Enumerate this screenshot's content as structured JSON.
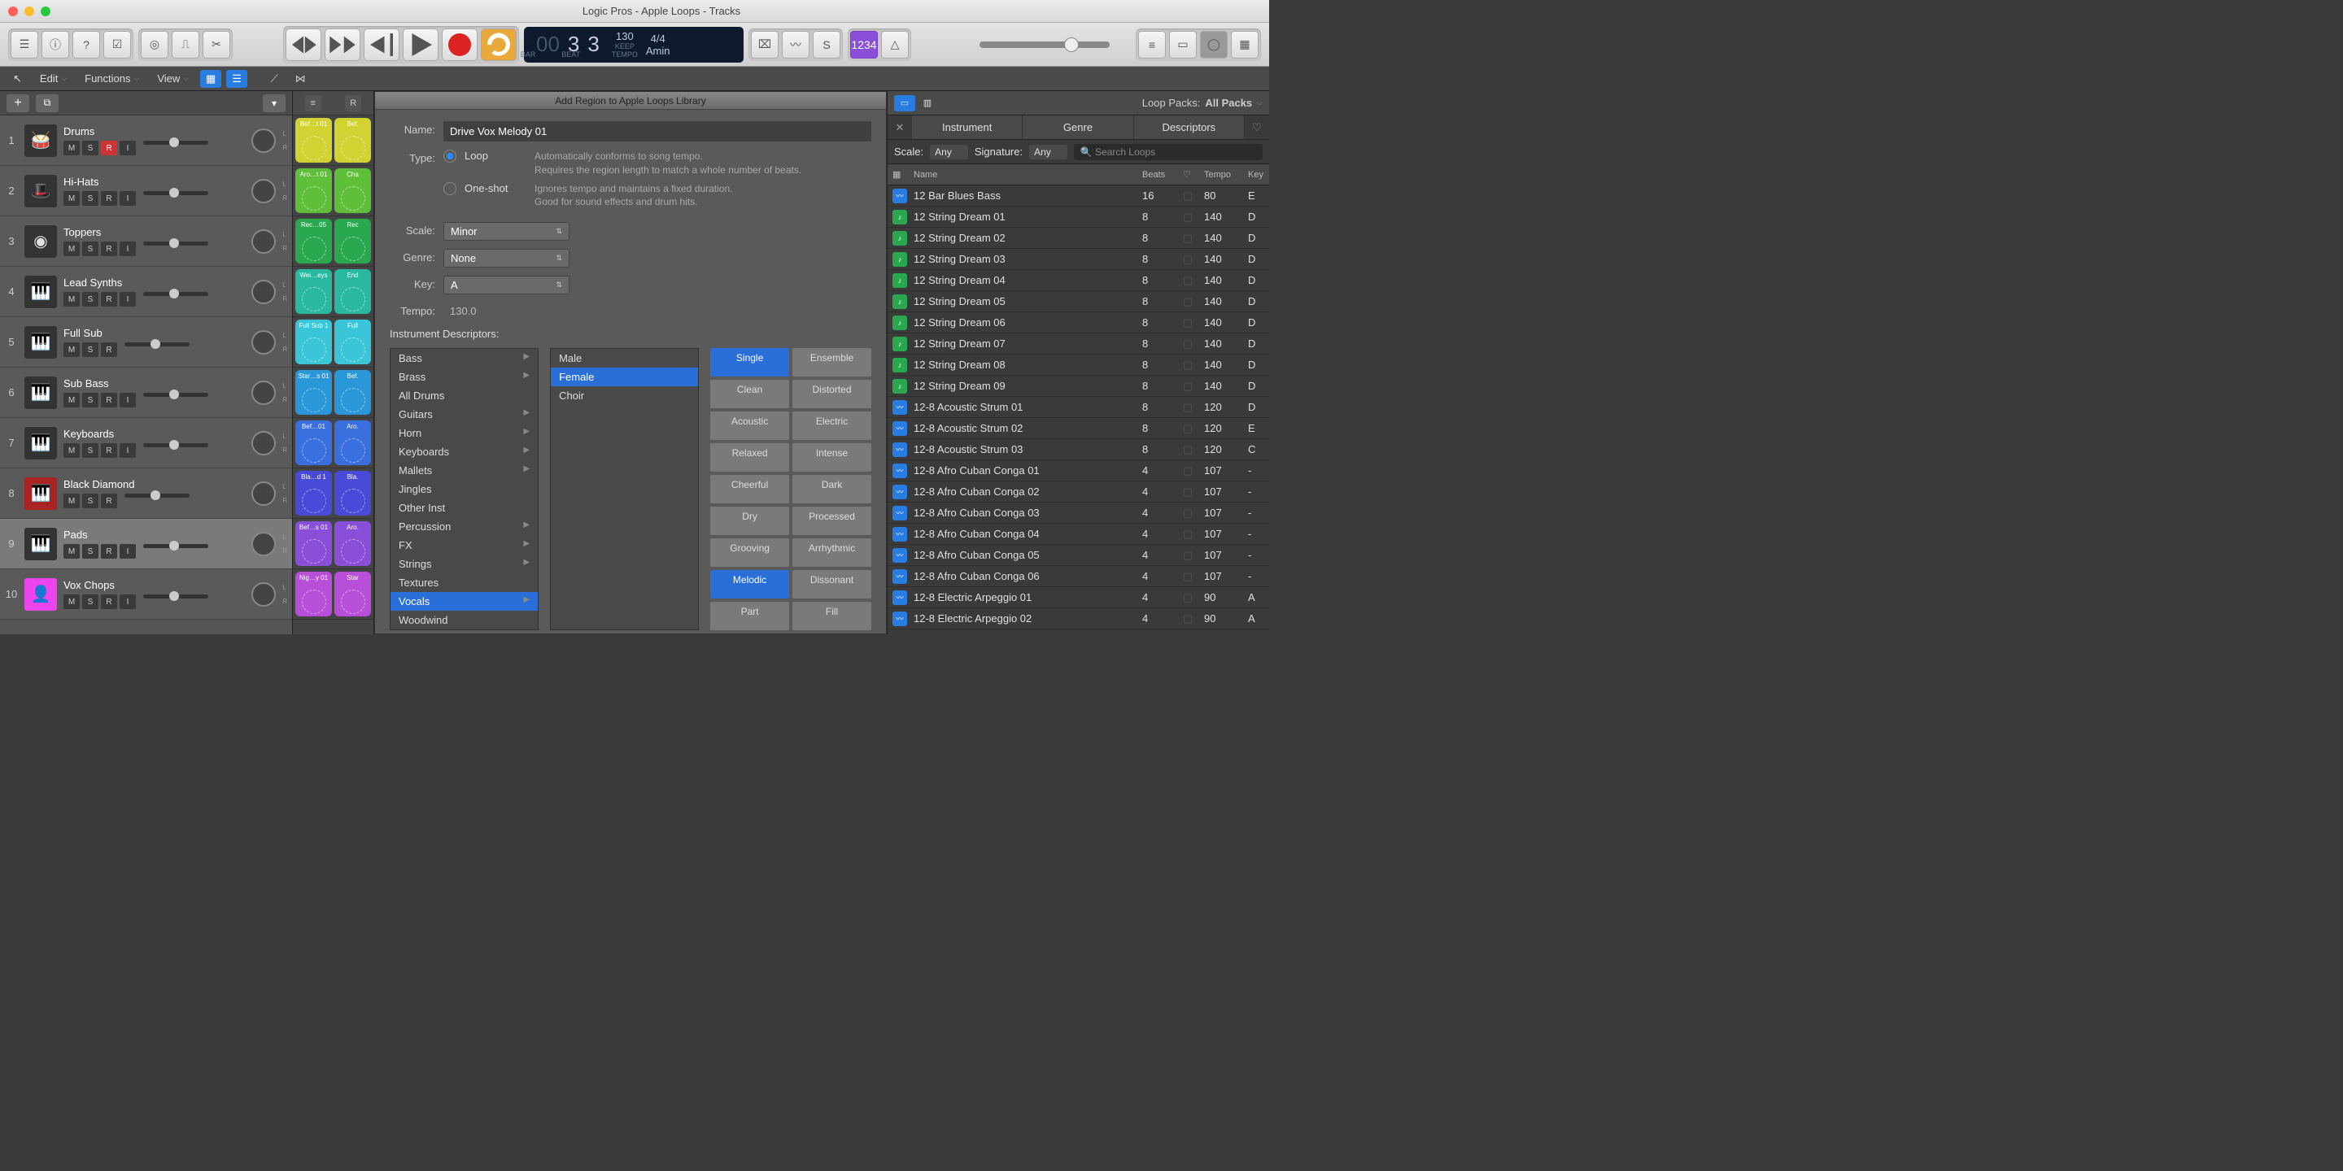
{
  "window": {
    "title": "Logic Pros - Apple Loops - Tracks",
    "doc_icon": "◧"
  },
  "lcd": {
    "bars": "00",
    "beat1": "3",
    "beat2": "3",
    "bar_label": "BAR",
    "beat_label": "BEAT",
    "tempo": "130",
    "tempo_l1": "KEEP",
    "tempo_l2": "TEMPO",
    "sig": "4/4",
    "key": "Amin"
  },
  "toolbar2": {
    "edit": "Edit",
    "functions": "Functions",
    "view": "View"
  },
  "tracks": [
    {
      "n": "1",
      "name": "Drums",
      "btns": [
        "M",
        "S",
        "R",
        "I"
      ],
      "rec": true,
      "color": "#333",
      "ic": "🥁"
    },
    {
      "n": "2",
      "name": "Hi-Hats",
      "btns": [
        "M",
        "S",
        "R",
        "I"
      ],
      "color": "#333",
      "ic": "🎩"
    },
    {
      "n": "3",
      "name": "Toppers",
      "btns": [
        "M",
        "S",
        "R",
        "I"
      ],
      "color": "#333",
      "ic": "◉"
    },
    {
      "n": "4",
      "name": "Lead Synths",
      "btns": [
        "M",
        "S",
        "R",
        "I"
      ],
      "color": "#333",
      "ic": "🎹"
    },
    {
      "n": "5",
      "name": "Full Sub",
      "btns": [
        "M",
        "S",
        "R"
      ],
      "color": "#333",
      "ic": "🎹"
    },
    {
      "n": "6",
      "name": "Sub Bass",
      "btns": [
        "M",
        "S",
        "R",
        "I"
      ],
      "color": "#333",
      "ic": "🎹"
    },
    {
      "n": "7",
      "name": "Keyboards",
      "btns": [
        "M",
        "S",
        "R",
        "I"
      ],
      "color": "#333",
      "ic": "🎹"
    },
    {
      "n": "8",
      "name": "Black Diamond",
      "btns": [
        "M",
        "S",
        "R"
      ],
      "color": "#a22",
      "ic": "🎹"
    },
    {
      "n": "9",
      "name": "Pads",
      "btns": [
        "M",
        "S",
        "R",
        "I"
      ],
      "sel": true,
      "color": "#333",
      "ic": "🎹"
    },
    {
      "n": "10",
      "name": "Vox Chops",
      "btns": [
        "M",
        "S",
        "R",
        "I"
      ],
      "color": "#e4e",
      "ic": "👤"
    }
  ],
  "cells": [
    [
      {
        "l": "Bef…t 01",
        "c": "#d2d233"
      },
      {
        "l": "Bef.",
        "c": "#d2d233"
      }
    ],
    [
      {
        "l": "Aro…t 01",
        "c": "#5fbf3a"
      },
      {
        "l": "Cha",
        "c": "#5fbf3a"
      }
    ],
    [
      {
        "l": "Rec…05",
        "c": "#2aa850"
      },
      {
        "l": "Rec",
        "c": "#2aa850"
      }
    ],
    [
      {
        "l": "Wei…eys",
        "c": "#2ab8a0"
      },
      {
        "l": "End",
        "c": "#2ab8a0"
      }
    ],
    [
      {
        "l": "Full Sub 1",
        "c": "#3ac5d8"
      },
      {
        "l": "Full",
        "c": "#3ac5d8"
      }
    ],
    [
      {
        "l": "Star…s 01",
        "c": "#2a98d8"
      },
      {
        "l": "Bef.",
        "c": "#2a98d8"
      }
    ],
    [
      {
        "l": "Bef…01",
        "c": "#3a6fe0"
      },
      {
        "l": "Aro.",
        "c": "#3a6fe0"
      }
    ],
    [
      {
        "l": "Bla…d 1",
        "c": "#4a4ad8"
      },
      {
        "l": "Bla.",
        "c": "#4a4ad8"
      }
    ],
    [
      {
        "l": "Bef…s 01",
        "c": "#8a4fd8"
      },
      {
        "l": "Aro.",
        "c": "#8a4fd8"
      }
    ],
    [
      {
        "l": "Nig…y 01",
        "c": "#b84fd8"
      },
      {
        "l": "Star",
        "c": "#b84fd8"
      }
    ]
  ],
  "dialog": {
    "title": "Add Region to Apple Loops Library",
    "name_label": "Name:",
    "name_value": "Drive Vox Melody 01",
    "type_label": "Type:",
    "loop_label": "Loop",
    "loop_desc1": "Automatically conforms to song tempo.",
    "loop_desc2": "Requires the region length to match a whole number of beats.",
    "oneshot_label": "One-shot",
    "oneshot_desc1": "Ignores tempo and maintains a fixed duration.",
    "oneshot_desc2": "Good for sound effects and drum hits.",
    "scale_label": "Scale:",
    "scale_value": "Minor",
    "genre_label": "Genre:",
    "genre_value": "None",
    "key_label": "Key:",
    "key_value": "A",
    "tempo_label": "Tempo:",
    "tempo_value": "130.0",
    "desc_heading": "Instrument Descriptors:",
    "col1": [
      "Bass",
      "Brass",
      "All Drums",
      "Guitars",
      "Horn",
      "Keyboards",
      "Mallets",
      "Jingles",
      "Other Inst",
      "Percussion",
      "FX",
      "Strings",
      "Textures",
      "Vocals",
      "Woodwind"
    ],
    "col1_arrows": [
      true,
      true,
      false,
      true,
      true,
      true,
      true,
      false,
      false,
      true,
      true,
      true,
      false,
      true,
      false
    ],
    "col1_sel": 13,
    "col2": [
      "Male",
      "Female",
      "Choir"
    ],
    "col2_sel": 1,
    "tags": [
      [
        "Single",
        "Ensemble"
      ],
      [
        "Clean",
        "Distorted"
      ],
      [
        "Acoustic",
        "Electric"
      ],
      [
        "Relaxed",
        "Intense"
      ],
      [
        "Cheerful",
        "Dark"
      ],
      [
        "Dry",
        "Processed"
      ],
      [
        "Grooving",
        "Arrhythmic"
      ],
      [
        "Melodic",
        "Dissonant"
      ],
      [
        "Part",
        "Fill"
      ]
    ],
    "tags_sel": [
      [
        true,
        false
      ],
      [
        false,
        false
      ],
      [
        false,
        false
      ],
      [
        false,
        false
      ],
      [
        false,
        false
      ],
      [
        false,
        false
      ],
      [
        false,
        false
      ],
      [
        true,
        false
      ],
      [
        false,
        false
      ]
    ]
  },
  "loops": {
    "packs_label": "Loop Packs:",
    "packs_value": "All Packs",
    "tabs": [
      "Instrument",
      "Genre",
      "Descriptors"
    ],
    "scale_label": "Scale:",
    "scale_value": "Any",
    "sig_label": "Signature:",
    "sig_value": "Any",
    "search_placeholder": "Search Loops",
    "cols": {
      "name": "Name",
      "beats": "Beats",
      "tempo": "Tempo",
      "key": "Key"
    },
    "rows": [
      {
        "t": "audio",
        "name": "12 Bar Blues Bass",
        "beats": "16",
        "tempo": "80",
        "key": "E"
      },
      {
        "t": "midi",
        "name": "12 String Dream 01",
        "beats": "8",
        "tempo": "140",
        "key": "D"
      },
      {
        "t": "midi",
        "name": "12 String Dream 02",
        "beats": "8",
        "tempo": "140",
        "key": "D"
      },
      {
        "t": "midi",
        "name": "12 String Dream 03",
        "beats": "8",
        "tempo": "140",
        "key": "D"
      },
      {
        "t": "midi",
        "name": "12 String Dream 04",
        "beats": "8",
        "tempo": "140",
        "key": "D"
      },
      {
        "t": "midi",
        "name": "12 String Dream 05",
        "beats": "8",
        "tempo": "140",
        "key": "D"
      },
      {
        "t": "midi",
        "name": "12 String Dream 06",
        "beats": "8",
        "tempo": "140",
        "key": "D"
      },
      {
        "t": "midi",
        "name": "12 String Dream 07",
        "beats": "8",
        "tempo": "140",
        "key": "D"
      },
      {
        "t": "midi",
        "name": "12 String Dream 08",
        "beats": "8",
        "tempo": "140",
        "key": "D"
      },
      {
        "t": "midi",
        "name": "12 String Dream 09",
        "beats": "8",
        "tempo": "140",
        "key": "D"
      },
      {
        "t": "audio",
        "name": "12-8 Acoustic Strum 01",
        "beats": "8",
        "tempo": "120",
        "key": "D"
      },
      {
        "t": "audio",
        "name": "12-8 Acoustic Strum 02",
        "beats": "8",
        "tempo": "120",
        "key": "E"
      },
      {
        "t": "audio",
        "name": "12-8 Acoustic Strum 03",
        "beats": "8",
        "tempo": "120",
        "key": "C"
      },
      {
        "t": "audio",
        "name": "12-8 Afro Cuban Conga 01",
        "beats": "4",
        "tempo": "107",
        "key": "-"
      },
      {
        "t": "audio",
        "name": "12-8 Afro Cuban Conga 02",
        "beats": "4",
        "tempo": "107",
        "key": "-"
      },
      {
        "t": "audio",
        "name": "12-8 Afro Cuban Conga 03",
        "beats": "4",
        "tempo": "107",
        "key": "-"
      },
      {
        "t": "audio",
        "name": "12-8 Afro Cuban Conga 04",
        "beats": "4",
        "tempo": "107",
        "key": "-"
      },
      {
        "t": "audio",
        "name": "12-8 Afro Cuban Conga 05",
        "beats": "4",
        "tempo": "107",
        "key": "-"
      },
      {
        "t": "audio",
        "name": "12-8 Afro Cuban Conga 06",
        "beats": "4",
        "tempo": "107",
        "key": "-"
      },
      {
        "t": "audio",
        "name": "12-8 Electric Arpeggio 01",
        "beats": "4",
        "tempo": "90",
        "key": "A"
      },
      {
        "t": "audio",
        "name": "12-8 Electric Arpeggio 02",
        "beats": "4",
        "tempo": "90",
        "key": "A"
      }
    ]
  },
  "colors": {
    "accent": "#2a7de0"
  }
}
